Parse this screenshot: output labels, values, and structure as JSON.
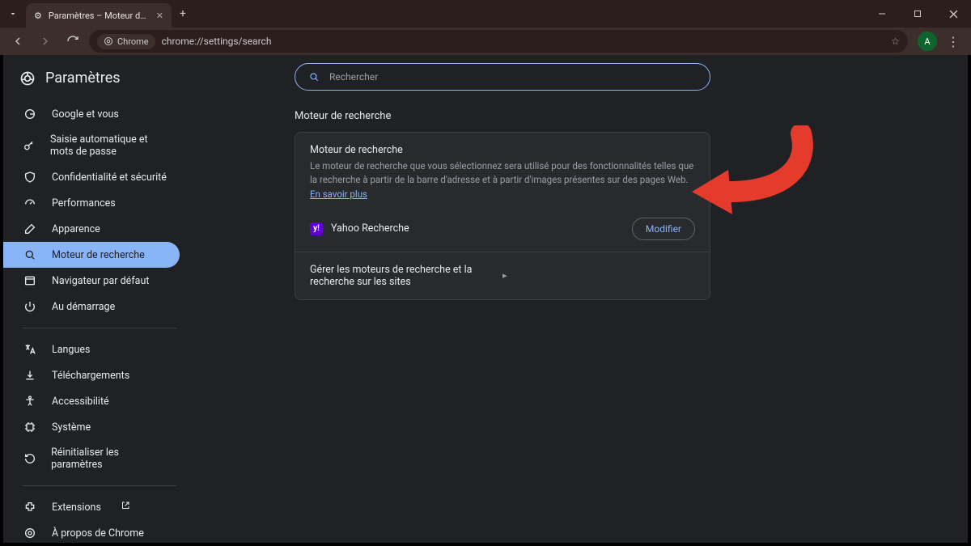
{
  "window": {
    "tab_title": "Paramètres – Moteur de recherc",
    "url_chip": "Chrome",
    "url": "chrome://settings/search",
    "avatar_letter": "A"
  },
  "brand": {
    "title": "Paramètres"
  },
  "search": {
    "placeholder": "Rechercher"
  },
  "sidebar": {
    "items": [
      {
        "label": "Google et vous"
      },
      {
        "label": "Saisie automatique et mots de passe"
      },
      {
        "label": "Confidentialité et sécurité"
      },
      {
        "label": "Performances"
      },
      {
        "label": "Apparence"
      },
      {
        "label": "Moteur de recherche"
      },
      {
        "label": "Navigateur par défaut"
      },
      {
        "label": "Au démarrage"
      }
    ],
    "items2": [
      {
        "label": "Langues"
      },
      {
        "label": "Téléchargements"
      },
      {
        "label": "Accessibilité"
      },
      {
        "label": "Système"
      },
      {
        "label": "Réinitialiser les paramètres"
      }
    ],
    "items3": [
      {
        "label": "Extensions"
      },
      {
        "label": "À propos de Chrome"
      }
    ]
  },
  "section": {
    "title": "Moteur de recherche"
  },
  "card": {
    "heading": "Moteur de recherche",
    "desc_prefix": "Le moteur de recherche que vous sélectionnez sera utilisé pour des fonctionnalités telles que la recherche à partir de la barre d'adresse et à partir d'images présentes sur des pages Web. ",
    "learn_more": "En savoir plus",
    "engine_name": "Yahoo Recherche",
    "modify_label": "Modifier",
    "manage_label": "Gérer les moteurs de recherche et la recherche sur les sites"
  }
}
